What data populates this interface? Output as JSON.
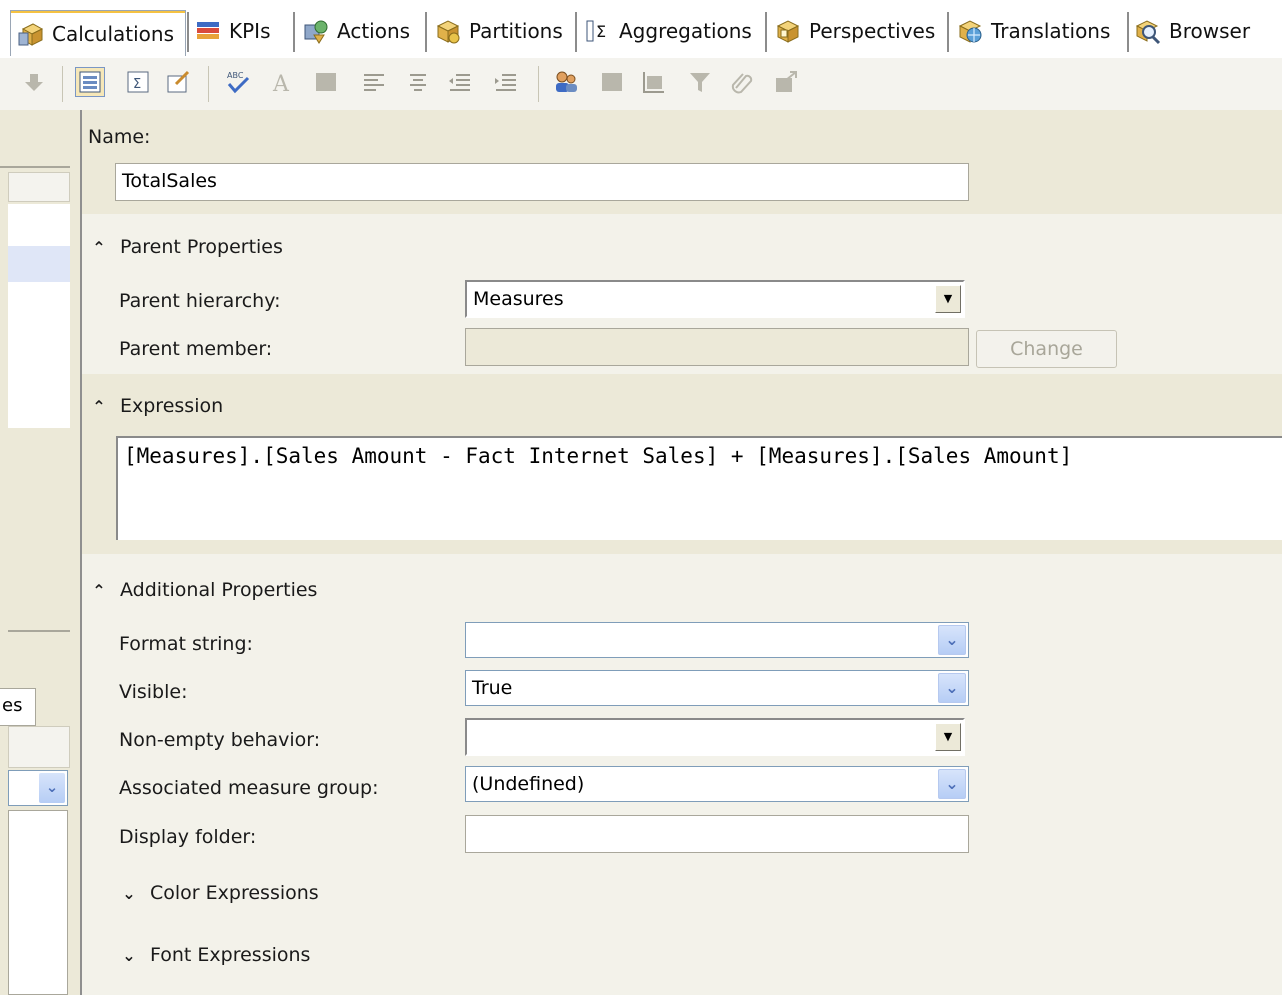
{
  "tabs": [
    {
      "label": "Calculations",
      "icon": "cube-calculator-icon",
      "active": true
    },
    {
      "label": "KPIs",
      "icon": "kpi-bars-icon"
    },
    {
      "label": "Actions",
      "icon": "actions-icon"
    },
    {
      "label": "Partitions",
      "icon": "partitions-icon"
    },
    {
      "label": "Aggregations",
      "icon": "aggregations-sigma-icon"
    },
    {
      "label": "Perspectives",
      "icon": "perspectives-icon"
    },
    {
      "label": "Translations",
      "icon": "translations-globe-icon"
    },
    {
      "label": "Browser",
      "icon": "browser-magnifier-icon"
    }
  ],
  "form": {
    "name_label": "Name:",
    "name_value": "TotalSales",
    "parent_section": "Parent Properties",
    "parent_hierarchy_label": "Parent hierarchy:",
    "parent_hierarchy_value": "Measures",
    "parent_member_label": "Parent member:",
    "parent_member_value": "",
    "change_button": "Change",
    "expression_section": "Expression",
    "expression_value": "[Measures].[Sales Amount - Fact Internet Sales] + [Measures].[Sales Amount]",
    "additional_section": "Additional Properties",
    "format_string_label": "Format string:",
    "format_string_value": "",
    "visible_label": "Visible:",
    "visible_value": "True",
    "non_empty_label": "Non-empty behavior:",
    "non_empty_value": "",
    "measure_group_label": "Associated measure group:",
    "measure_group_value": "(Undefined)",
    "display_folder_label": "Display folder:",
    "display_folder_value": "",
    "color_section": "Color Expressions",
    "font_section": "Font Expressions"
  },
  "left_panel": {
    "tab_fragment": "es"
  },
  "colors": {
    "panel": "#ece9d8",
    "xp_border": "#7f9db9",
    "selection": "#dfe6f7"
  }
}
